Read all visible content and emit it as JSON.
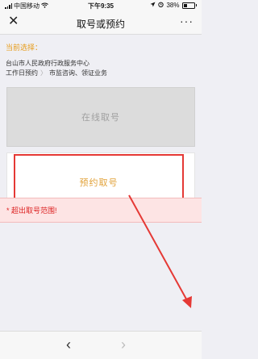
{
  "status_bar": {
    "carrier": "中国移动",
    "time": "下午9:35",
    "battery": "38%"
  },
  "nav": {
    "title": "取号或预约",
    "close_icon": "close-icon",
    "more_icon": "more-icon"
  },
  "selection": {
    "label": "当前选择：",
    "line1": "台山市人民政府行政服务中心",
    "line2_part1": "工作日预约",
    "line2_sep": "〉",
    "line2_part2": "市监咨询、领证业务"
  },
  "buttons": {
    "online": "在线取号",
    "appointment": "预约取号"
  },
  "error": {
    "message": "* 超出取号范围!"
  },
  "colors": {
    "accent": "#e79c1b",
    "highlight_border": "#e53935",
    "error_text": "#dd2222",
    "error_bg": "#fde4e4"
  },
  "bottom": {
    "back_icon": "chevron-left-icon",
    "forward_icon": "chevron-right-icon"
  }
}
